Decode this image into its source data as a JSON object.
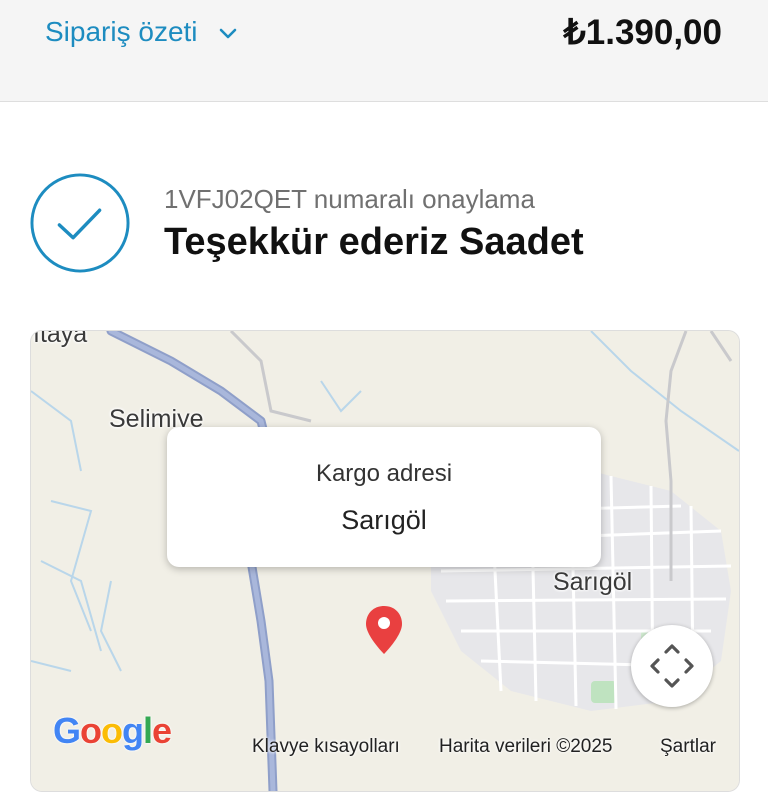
{
  "header": {
    "summary_label": "Sipariş özeti",
    "total": "₺1.390,00"
  },
  "confirmation": {
    "number_text": "1VFJ02QET numaralı onaylama",
    "thanks_text": "Teşekkür ederiz Saadet"
  },
  "map": {
    "labels": [
      "ıtaya",
      "Selimiye",
      "Sarıgöl"
    ],
    "popup_title": "Kargo adresi",
    "popup_city": "Sarıgöl",
    "logo_letters": [
      "G",
      "o",
      "o",
      "g",
      "l",
      "e"
    ],
    "logo_colors": [
      "#4285f4",
      "#ea4335",
      "#fbbc05",
      "#4285f4",
      "#34a853",
      "#ea4335"
    ],
    "attribution": {
      "shortcuts": "Klavye kısayolları",
      "data": "Harita verileri ©2025",
      "terms": "Şartlar"
    }
  },
  "colors": {
    "accent": "#1d8cc0",
    "pin": "#e94040"
  }
}
